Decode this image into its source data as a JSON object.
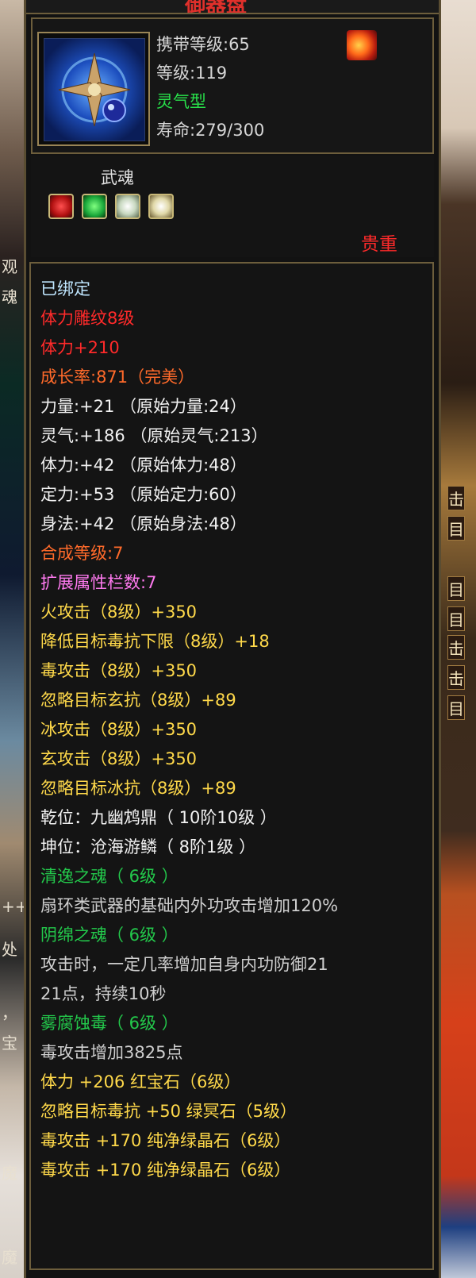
{
  "item": {
    "title": "御器盘",
    "carry_level": "携带等级:65",
    "level": "等级:119",
    "type": "灵气型",
    "life": "寿命:279/300"
  },
  "soul": {
    "title": "武魂",
    "precious": "贵重"
  },
  "details": [
    {
      "text": "已绑定",
      "color": "bound"
    },
    {
      "text": "体力雕纹8级",
      "color": "red"
    },
    {
      "text": "体力+210",
      "color": "red"
    },
    {
      "text": "成长率:871（完美）",
      "color": "orange"
    },
    {
      "text": "力量:+21 （原始力量:24）",
      "color": "white"
    },
    {
      "text": "灵气:+186 （原始灵气:213）",
      "color": "white"
    },
    {
      "text": "体力:+42 （原始体力:48）",
      "color": "white"
    },
    {
      "text": "定力:+53 （原始定力:60）",
      "color": "white"
    },
    {
      "text": "身法:+42 （原始身法:48）",
      "color": "white"
    },
    {
      "text": "合成等级:7",
      "color": "orange"
    },
    {
      "text": "扩展属性栏数:7",
      "color": "pink"
    },
    {
      "text": "火攻击（8级）+350",
      "color": "yellow"
    },
    {
      "text": "降低目标毒抗下限（8级）+18",
      "color": "yellow"
    },
    {
      "text": "毒攻击（8级）+350",
      "color": "yellow"
    },
    {
      "text": "忽略目标玄抗（8级）+89",
      "color": "yellow"
    },
    {
      "text": "冰攻击（8级）+350",
      "color": "yellow"
    },
    {
      "text": "玄攻击（8级）+350",
      "color": "yellow"
    },
    {
      "text": "忽略目标冰抗（8级）+89",
      "color": "yellow"
    },
    {
      "text": "乾位：九幽鸩鼎（ 10阶10级 ）",
      "color": "white"
    },
    {
      "text": "坤位：沧海游鳞（ 8阶1级 ）",
      "color": "white"
    },
    {
      "text": "清逸之魂（ 6级 ）",
      "color": "green"
    },
    {
      "text": "扇环类武器的基础内外功攻击增加120%",
      "color": "gray"
    },
    {
      "text": "阴绵之魂（ 6级 ）",
      "color": "green"
    },
    {
      "text": "攻击时，一定几率增加自身内功防御21",
      "color": "gray"
    },
    {
      "text": "21点，持续10秒",
      "color": "gray"
    },
    {
      "text": "雾腐蚀毒（ 6级 ）",
      "color": "green"
    },
    {
      "text": "毒攻击增加3825点",
      "color": "gray"
    },
    {
      "text": "体力 +206 红宝石（6级）",
      "color": "yellow"
    },
    {
      "text": "忽略目标毒抗 +50 绿冥石（5级）",
      "color": "yellow"
    },
    {
      "text": "毒攻击 +170 纯净绿晶石（6级）",
      "color": "yellow"
    },
    {
      "text": "毒攻击 +170 纯净绿晶石（6级）",
      "color": "yellow"
    }
  ],
  "background": {
    "left_texts": [
      "观",
      "魂",
      "++",
      "处",
      "，",
      "宝",
      "魔",
      "魔"
    ],
    "right_texts": [
      "击",
      "目",
      "目",
      "目",
      "击",
      "击",
      "目"
    ]
  },
  "colors": {
    "bound": "#bfe6ff",
    "red": "#ff2a2a",
    "orange": "#ff6a2a",
    "white": "#f2f2f2",
    "pink": "#ff7af0",
    "yellow": "#ffd94a",
    "green": "#23c84b",
    "gray": "#cfcfcf"
  },
  "icons": {
    "item": "shuriken-disc-icon",
    "fire": "fire-emblem-icon",
    "gems": [
      "red-gem-icon",
      "green-gem-icon",
      "white-gem-icon",
      "white-gem-icon"
    ]
  }
}
